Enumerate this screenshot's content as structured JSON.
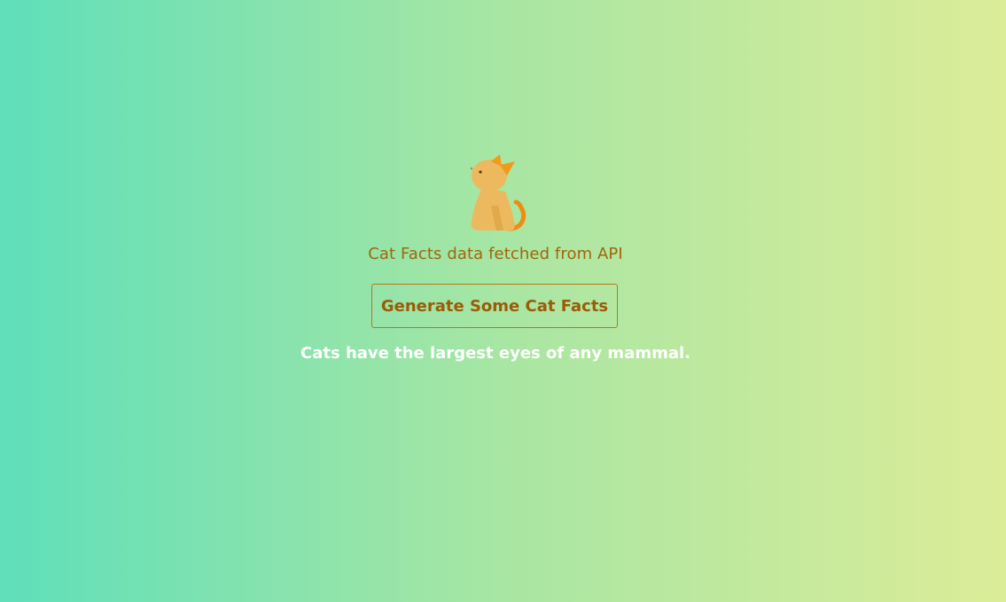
{
  "logo": {
    "icon": "cat-icon",
    "colors": {
      "body": "#edb95e",
      "ears": "#f39a1a",
      "tail": "#f08c12"
    }
  },
  "header": {
    "subtitle": "Cat Facts data fetched from API"
  },
  "actions": {
    "generate_label": "Generate Some Cat Facts"
  },
  "fact": {
    "text": "Cats have the largest eyes of any mammal."
  },
  "theme": {
    "gradient_start": "#5fdfba",
    "gradient_end": "#dcec98",
    "accent": "#9a5c08"
  }
}
